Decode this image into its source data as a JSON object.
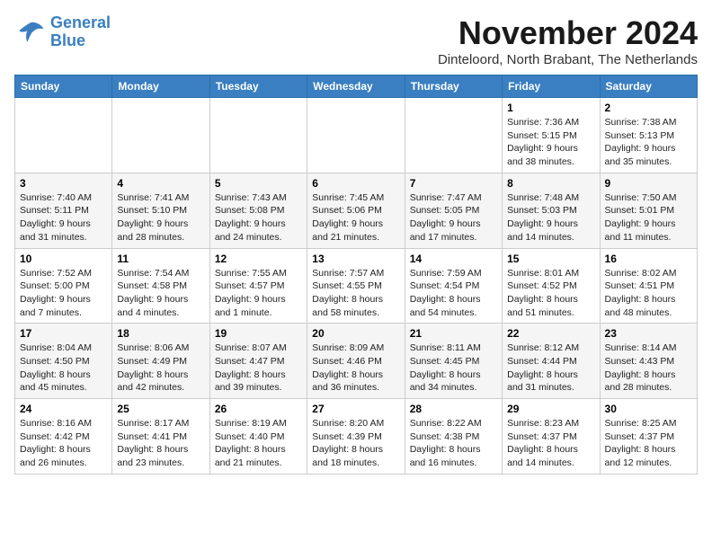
{
  "logo": {
    "line1": "General",
    "line2": "Blue"
  },
  "title": "November 2024",
  "location": "Dinteloord, North Brabant, The Netherlands",
  "weekdays": [
    "Sunday",
    "Monday",
    "Tuesday",
    "Wednesday",
    "Thursday",
    "Friday",
    "Saturday"
  ],
  "weeks": [
    [
      {
        "day": "",
        "info": ""
      },
      {
        "day": "",
        "info": ""
      },
      {
        "day": "",
        "info": ""
      },
      {
        "day": "",
        "info": ""
      },
      {
        "day": "",
        "info": ""
      },
      {
        "day": "1",
        "info": "Sunrise: 7:36 AM\nSunset: 5:15 PM\nDaylight: 9 hours\nand 38 minutes."
      },
      {
        "day": "2",
        "info": "Sunrise: 7:38 AM\nSunset: 5:13 PM\nDaylight: 9 hours\nand 35 minutes."
      }
    ],
    [
      {
        "day": "3",
        "info": "Sunrise: 7:40 AM\nSunset: 5:11 PM\nDaylight: 9 hours\nand 31 minutes."
      },
      {
        "day": "4",
        "info": "Sunrise: 7:41 AM\nSunset: 5:10 PM\nDaylight: 9 hours\nand 28 minutes."
      },
      {
        "day": "5",
        "info": "Sunrise: 7:43 AM\nSunset: 5:08 PM\nDaylight: 9 hours\nand 24 minutes."
      },
      {
        "day": "6",
        "info": "Sunrise: 7:45 AM\nSunset: 5:06 PM\nDaylight: 9 hours\nand 21 minutes."
      },
      {
        "day": "7",
        "info": "Sunrise: 7:47 AM\nSunset: 5:05 PM\nDaylight: 9 hours\nand 17 minutes."
      },
      {
        "day": "8",
        "info": "Sunrise: 7:48 AM\nSunset: 5:03 PM\nDaylight: 9 hours\nand 14 minutes."
      },
      {
        "day": "9",
        "info": "Sunrise: 7:50 AM\nSunset: 5:01 PM\nDaylight: 9 hours\nand 11 minutes."
      }
    ],
    [
      {
        "day": "10",
        "info": "Sunrise: 7:52 AM\nSunset: 5:00 PM\nDaylight: 9 hours\nand 7 minutes."
      },
      {
        "day": "11",
        "info": "Sunrise: 7:54 AM\nSunset: 4:58 PM\nDaylight: 9 hours\nand 4 minutes."
      },
      {
        "day": "12",
        "info": "Sunrise: 7:55 AM\nSunset: 4:57 PM\nDaylight: 9 hours\nand 1 minute."
      },
      {
        "day": "13",
        "info": "Sunrise: 7:57 AM\nSunset: 4:55 PM\nDaylight: 8 hours\nand 58 minutes."
      },
      {
        "day": "14",
        "info": "Sunrise: 7:59 AM\nSunset: 4:54 PM\nDaylight: 8 hours\nand 54 minutes."
      },
      {
        "day": "15",
        "info": "Sunrise: 8:01 AM\nSunset: 4:52 PM\nDaylight: 8 hours\nand 51 minutes."
      },
      {
        "day": "16",
        "info": "Sunrise: 8:02 AM\nSunset: 4:51 PM\nDaylight: 8 hours\nand 48 minutes."
      }
    ],
    [
      {
        "day": "17",
        "info": "Sunrise: 8:04 AM\nSunset: 4:50 PM\nDaylight: 8 hours\nand 45 minutes."
      },
      {
        "day": "18",
        "info": "Sunrise: 8:06 AM\nSunset: 4:49 PM\nDaylight: 8 hours\nand 42 minutes."
      },
      {
        "day": "19",
        "info": "Sunrise: 8:07 AM\nSunset: 4:47 PM\nDaylight: 8 hours\nand 39 minutes."
      },
      {
        "day": "20",
        "info": "Sunrise: 8:09 AM\nSunset: 4:46 PM\nDaylight: 8 hours\nand 36 minutes."
      },
      {
        "day": "21",
        "info": "Sunrise: 8:11 AM\nSunset: 4:45 PM\nDaylight: 8 hours\nand 34 minutes."
      },
      {
        "day": "22",
        "info": "Sunrise: 8:12 AM\nSunset: 4:44 PM\nDaylight: 8 hours\nand 31 minutes."
      },
      {
        "day": "23",
        "info": "Sunrise: 8:14 AM\nSunset: 4:43 PM\nDaylight: 8 hours\nand 28 minutes."
      }
    ],
    [
      {
        "day": "24",
        "info": "Sunrise: 8:16 AM\nSunset: 4:42 PM\nDaylight: 8 hours\nand 26 minutes."
      },
      {
        "day": "25",
        "info": "Sunrise: 8:17 AM\nSunset: 4:41 PM\nDaylight: 8 hours\nand 23 minutes."
      },
      {
        "day": "26",
        "info": "Sunrise: 8:19 AM\nSunset: 4:40 PM\nDaylight: 8 hours\nand 21 minutes."
      },
      {
        "day": "27",
        "info": "Sunrise: 8:20 AM\nSunset: 4:39 PM\nDaylight: 8 hours\nand 18 minutes."
      },
      {
        "day": "28",
        "info": "Sunrise: 8:22 AM\nSunset: 4:38 PM\nDaylight: 8 hours\nand 16 minutes."
      },
      {
        "day": "29",
        "info": "Sunrise: 8:23 AM\nSunset: 4:37 PM\nDaylight: 8 hours\nand 14 minutes."
      },
      {
        "day": "30",
        "info": "Sunrise: 8:25 AM\nSunset: 4:37 PM\nDaylight: 8 hours\nand 12 minutes."
      }
    ]
  ]
}
